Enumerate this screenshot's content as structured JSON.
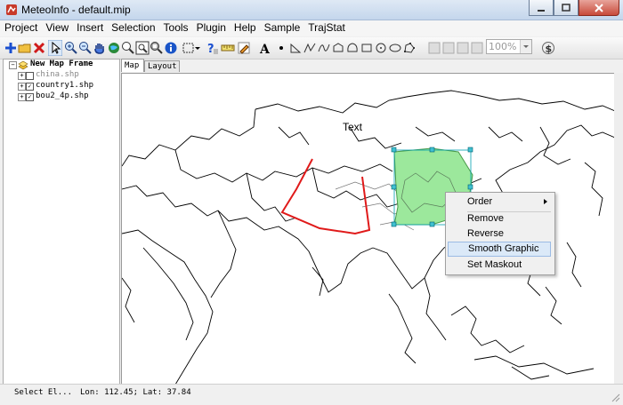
{
  "window": {
    "title": "MeteoInfo - default.mip"
  },
  "menu": [
    "Project",
    "View",
    "Insert",
    "Selection",
    "Tools",
    "Plugin",
    "Help",
    "Sample",
    "TrajStat"
  ],
  "toolbar": {
    "zoom_value": "100%"
  },
  "layers": {
    "frame": "New Map Frame",
    "items": [
      {
        "name": "china.shp",
        "checked": false
      },
      {
        "name": "country1.shp",
        "checked": true
      },
      {
        "name": "bou2_4p.shp",
        "checked": true
      }
    ]
  },
  "tabs": {
    "map": "Map",
    "layout": "Layout"
  },
  "map": {
    "text_label": "Text"
  },
  "context_menu": {
    "order": "Order",
    "remove": "Remove",
    "reverse": "Reverse",
    "smooth": "Smooth Graphic",
    "maskout": "Set Maskout"
  },
  "status": {
    "mode": "Select El...",
    "coords": "Lon: 112.45; Lat: 37.84"
  },
  "colors": {
    "polygon_fill": "#9ce89c",
    "polyline": "#e01a1a",
    "selection": "#00a0b0"
  }
}
